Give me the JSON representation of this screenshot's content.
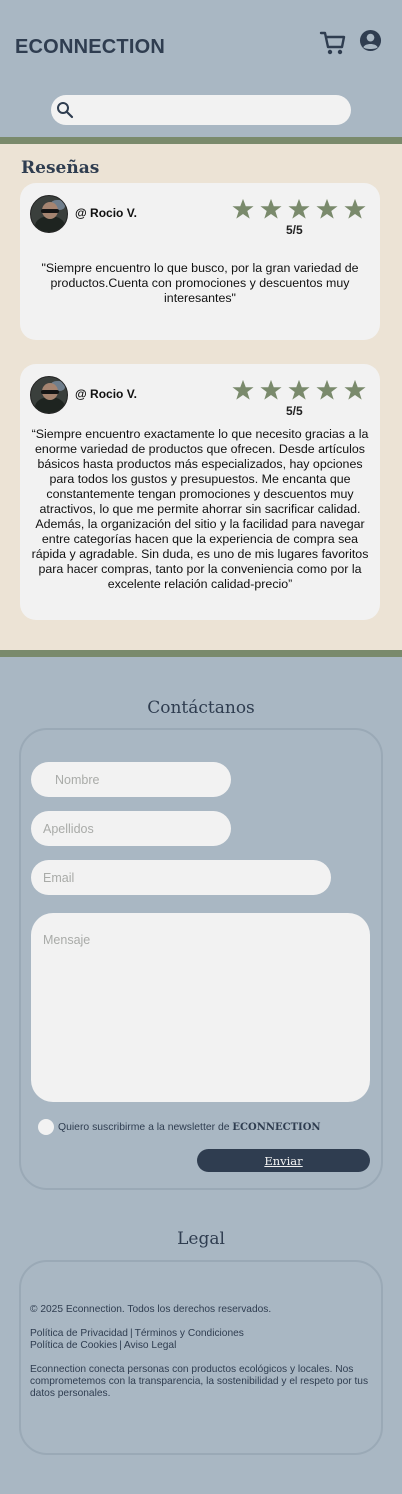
{
  "header": {
    "logo": "ECONNECTION",
    "search_placeholder": ""
  },
  "reviews": {
    "title": "Reseñas",
    "items": [
      {
        "user": "@ Rocio V.",
        "stars": 5,
        "rating": "5/5",
        "text": "\"Siempre encuentro lo que busco, por la gran variedad de productos.Cuenta con promociones y descuentos muy interesantes\""
      },
      {
        "user": "@ Rocio V.",
        "stars": 5,
        "rating": "5/5",
        "text": "“Siempre encuentro exactamente lo que necesito gracias a la enorme variedad de productos que ofrecen. Desde artículos básicos hasta productos más especializados, hay opciones para todos los gustos y presupuestos. Me encanta que constantemente tengan promociones y descuentos muy atractivos, lo que me permite ahorrar sin sacrificar calidad. Además, la organización del sitio y la facilidad para navegar entre categorías hacen que la experiencia de compra sea rápida y agradable. Sin duda, es uno de mis lugares favoritos para hacer compras, tanto por la conveniencia como por la excelente relación calidad-precio”"
      }
    ]
  },
  "contact": {
    "title": "Contáctanos",
    "nombre_placeholder": "Nombre",
    "apellidos_placeholder": "Apellidos",
    "email_placeholder": "Email",
    "mensaje_placeholder": "Mensaje",
    "newsletter_label": "Quiero suscribirme a la newsletter de",
    "newsletter_brand": "ECONNECTION",
    "send_label": "Enviar"
  },
  "legal": {
    "title": "Legal",
    "copyright": "© 2025 Econnection. Todos los derechos reservados.",
    "privacy": "Política de Privacidad",
    "terms": "Términos y Condiciones",
    "cookies": "Política de Cookies",
    "notice": "Aviso Legal",
    "separator": "|",
    "description": "Econnection conecta personas con productos ecológicos y locales. Nos comprometemos con la transparencia, la sostenibilidad y el respeto por tus datos personales."
  },
  "colors": {
    "background": "#a9b7c3",
    "reviews_background": "#ece3d5",
    "accent_green": "#7a8a6c",
    "dark_navy": "#2f3d50",
    "card": "#f2f2f2"
  },
  "icons": [
    "cart-icon",
    "user-circle-icon",
    "search-icon",
    "star-icon"
  ]
}
